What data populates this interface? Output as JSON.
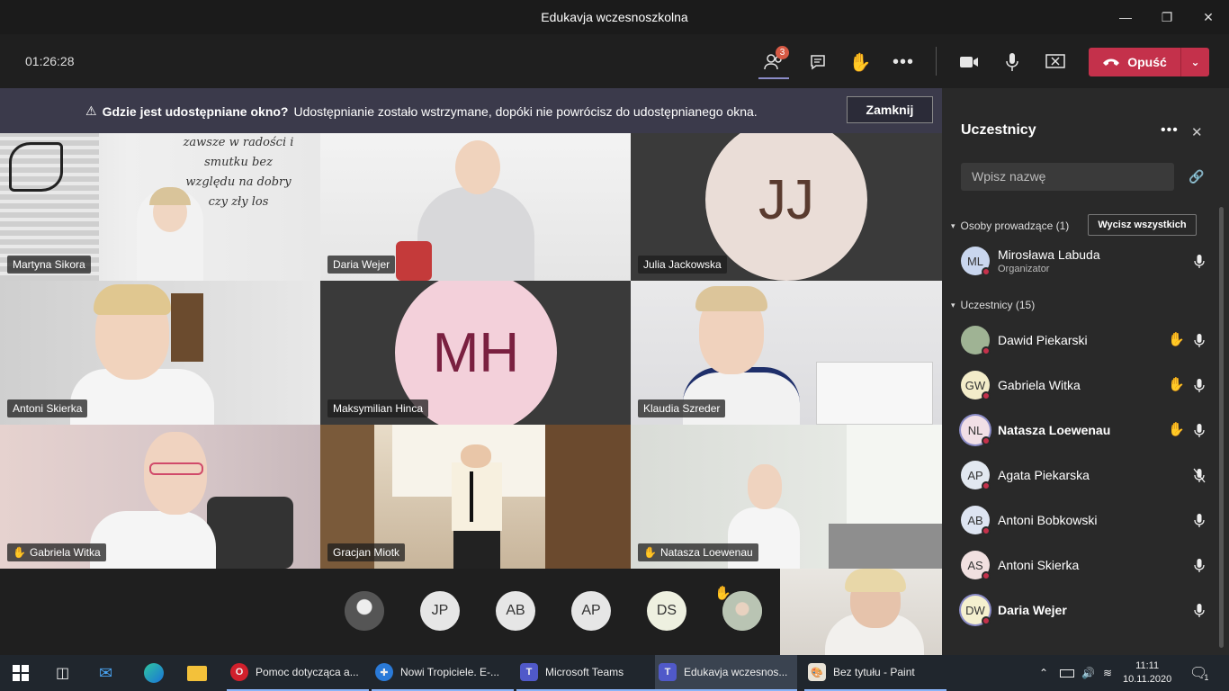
{
  "window": {
    "title": "Edukavja wczesnoszkolna",
    "minimize_icon": "minimize-icon",
    "maximize_icon": "maximize-icon",
    "close_icon": "close-icon"
  },
  "toolbar": {
    "timer": "01:26:28",
    "participants_badge": "3",
    "leave_label": "Opuść"
  },
  "banner": {
    "title": "Gdzie jest udostępniane okno?",
    "message": "Udostępnianie zostało wstrzymane, dopóki nie powrócisz do udostępnianego okna.",
    "close_label": "Zamknij"
  },
  "grid": {
    "tiles": [
      {
        "name": "Martyna Sikora",
        "hand": false,
        "photo_text": "zawsze w radości i smutku bez względu na dobry czy zły los"
      },
      {
        "name": "Daria Wejer",
        "hand": false
      },
      {
        "name": "Julia Jackowska",
        "hand": false,
        "initials": "JJ"
      },
      {
        "name": "Antoni Skierka",
        "hand": false
      },
      {
        "name": "Maksymilian Hinca",
        "hand": false,
        "initials": "MH"
      },
      {
        "name": "Klaudia Szreder",
        "hand": false
      },
      {
        "name": "Gabriela Witka",
        "hand": true
      },
      {
        "name": "Gracjan Miotk",
        "hand": false
      },
      {
        "name": "Natasza Loewenau",
        "hand": true
      }
    ],
    "overflow": [
      "JP",
      "AB",
      "AP",
      "DS"
    ]
  },
  "panel": {
    "title": "Uczestnicy",
    "search_placeholder": "Wpisz nazwę",
    "presenters_label": "Osoby prowadzące (1)",
    "mute_all_label": "Wycisz wszystkich",
    "organizer": {
      "initials": "ML",
      "name": "Mirosława Labuda",
      "role": "Organizator"
    },
    "attendees_label": "Uczestnicy (15)",
    "people": [
      {
        "initials": "",
        "name": "Dawid Piekarski",
        "hand": true,
        "bold": false,
        "muted": false
      },
      {
        "initials": "GW",
        "name": "Gabriela Witka",
        "hand": true,
        "bold": false,
        "muted": false
      },
      {
        "initials": "NL",
        "name": "Natasza Loewenau",
        "hand": true,
        "bold": true,
        "muted": false
      },
      {
        "initials": "AP",
        "name": "Agata Piekarska",
        "hand": false,
        "bold": false,
        "muted": true
      },
      {
        "initials": "AB",
        "name": "Antoni Bobkowski",
        "hand": false,
        "bold": false,
        "muted": false
      },
      {
        "initials": "AS",
        "name": "Antoni Skierka",
        "hand": false,
        "bold": false,
        "muted": false
      },
      {
        "initials": "DW",
        "name": "Daria Wejer",
        "hand": false,
        "bold": true,
        "muted": false
      }
    ]
  },
  "taskbar": {
    "apps": [
      {
        "label": "Pomoc dotycząca a...",
        "icon": "opera-icon"
      },
      {
        "label": "Nowi Tropiciele. E-...",
        "icon": "puzzle-icon"
      },
      {
        "label": "Microsoft Teams",
        "icon": "teams-icon"
      },
      {
        "label": "Edukavja wczesnos...",
        "icon": "teams-icon"
      },
      {
        "label": "Bez tytułu - Paint",
        "icon": "paint-icon"
      }
    ],
    "time": "11:11",
    "date": "10.11.2020",
    "notifications": "1"
  }
}
